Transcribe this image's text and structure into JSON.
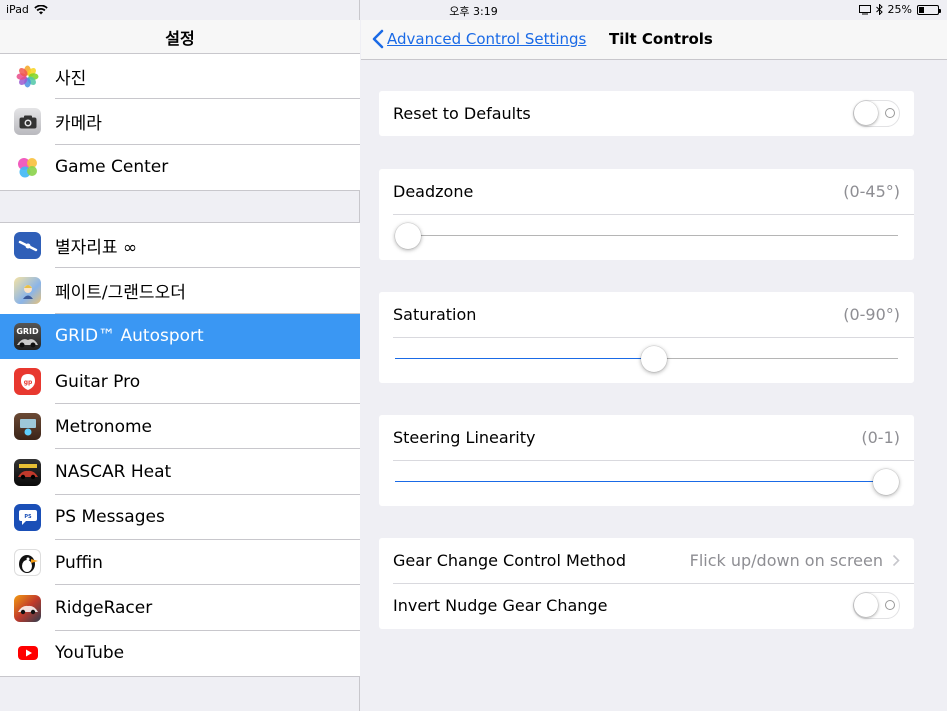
{
  "status_bar": {
    "device": "iPad",
    "time": "오후 3:19",
    "battery": "25%",
    "battery_level": 0.25
  },
  "sidebar": {
    "title": "설정",
    "group1": [
      {
        "label": "사진",
        "icon": "photos-icon"
      },
      {
        "label": "카메라",
        "icon": "camera-icon"
      },
      {
        "label": "Game Center",
        "icon": "game-center-icon"
      }
    ],
    "group2": [
      {
        "label": "별자리표 ∞",
        "icon": "star-chart-icon"
      },
      {
        "label": "페이트/그랜드오더",
        "icon": "fate-grand-order-icon"
      },
      {
        "label": "GRID™ Autosport",
        "icon": "grid-autosport-icon",
        "selected": true
      },
      {
        "label": "Guitar Pro",
        "icon": "guitar-pro-icon"
      },
      {
        "label": "Metronome",
        "icon": "metronome-icon"
      },
      {
        "label": "NASCAR Heat",
        "icon": "nascar-heat-icon"
      },
      {
        "label": "PS Messages",
        "icon": "ps-messages-icon"
      },
      {
        "label": "Puffin",
        "icon": "puffin-icon"
      },
      {
        "label": "RidgeRacer",
        "icon": "ridgeracer-icon"
      },
      {
        "label": "YouTube",
        "icon": "youtube-icon"
      }
    ]
  },
  "detail": {
    "back_label": "Advanced Control Settings",
    "title": "Tilt Controls",
    "reset": {
      "label": "Reset to Defaults",
      "on": false
    },
    "deadzone": {
      "label": "Deadzone",
      "range": "(0-45°)",
      "value_fraction": 0.0
    },
    "saturation": {
      "label": "Saturation",
      "range": "(0-90°)",
      "value_fraction": 0.514
    },
    "steering": {
      "label": "Steering Linearity",
      "range": "(0-1)",
      "value_fraction": 0.977
    },
    "gear_method": {
      "label": "Gear Change Control Method",
      "value": "Flick up/down on screen"
    },
    "invert_nudge": {
      "label": "Invert Nudge Gear Change",
      "on": false
    }
  },
  "colors": {
    "accent": "#1a6ae6",
    "selection": "#3a97f3",
    "background": "#efeff4"
  }
}
